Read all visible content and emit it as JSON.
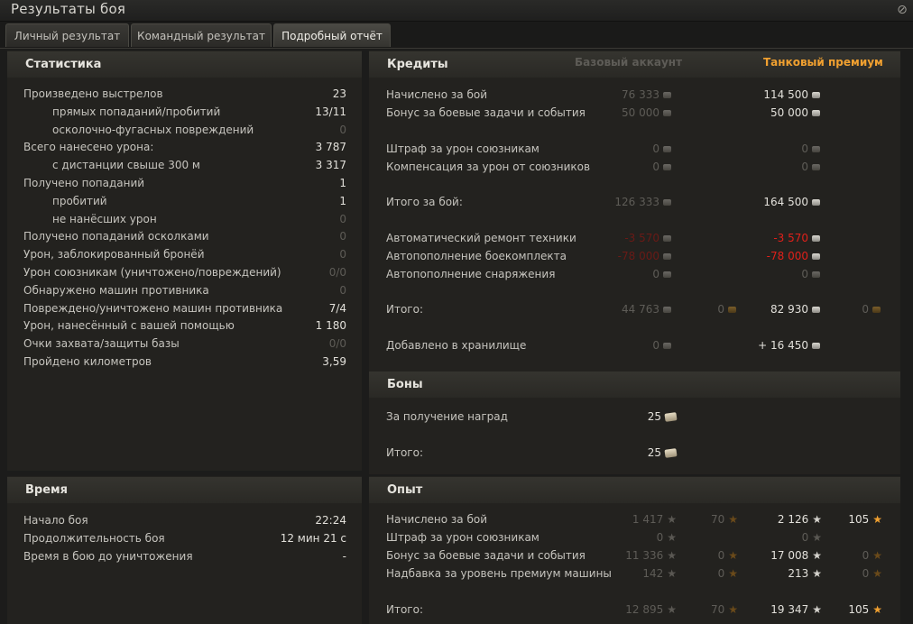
{
  "window": {
    "title": "Результаты боя"
  },
  "tabs": [
    {
      "label": "Личный результат"
    },
    {
      "label": "Командный результат"
    },
    {
      "label": "Подробный отчёт"
    }
  ],
  "stats": {
    "header": "Статистика",
    "rows": [
      {
        "label": "Произведено выстрелов",
        "value": "23"
      },
      {
        "label": "прямых попаданий/пробитий",
        "value": "13/11"
      },
      {
        "label": "осколочно-фугасных повреждений",
        "value": "0"
      },
      {
        "label": "Всего нанесено урона:",
        "value": "3 787"
      },
      {
        "label": "с дистанции свыше 300 м",
        "value": "3 317"
      },
      {
        "label": "Получено попаданий",
        "value": "1"
      },
      {
        "label": "пробитий",
        "value": "1"
      },
      {
        "label": "не нанёсших урон",
        "value": "0"
      },
      {
        "label": "Получено попаданий осколками",
        "value": "0"
      },
      {
        "label": "Урон, заблокированный бронёй",
        "value": "0"
      },
      {
        "label": "Урон союзникам (уничтожено/повреждений)",
        "value": "0/0"
      },
      {
        "label": "Обнаружено машин противника",
        "value": "0"
      },
      {
        "label": "Повреждено/уничтожено машин противника",
        "value": "7/4"
      },
      {
        "label": "Урон, нанесённый с вашей помощью",
        "value": "1 180"
      },
      {
        "label": "Очки захвата/защиты базы",
        "value": "0/0"
      },
      {
        "label": "Пройдено километров",
        "value": "3,59"
      }
    ]
  },
  "time": {
    "header": "Время",
    "rows": [
      {
        "label": "Начало боя",
        "value": "22:24"
      },
      {
        "label": "Продолжительность боя",
        "value": "12 мин 21 с"
      },
      {
        "label": "Время в бою до уничтожения",
        "value": "-"
      }
    ]
  },
  "credits": {
    "header": "Кредиты",
    "col_basic": "Базовый аккаунт",
    "col_premium": "Танковый премиум",
    "rows": [
      {
        "label": "Начислено за бой",
        "basic": "76 333",
        "premium": "114 500"
      },
      {
        "label": "Бонус за боевые задачи и события",
        "basic": "50 000",
        "premium": "50 000"
      },
      {
        "label": "Штраф за урон союзникам",
        "basic": "0",
        "premium": "0"
      },
      {
        "label": "Компенсация за урон от союзников",
        "basic": "0",
        "premium": "0"
      },
      {
        "label": "Итого за бой:",
        "basic": "126 333",
        "premium": "164 500"
      },
      {
        "label": "Автоматический ремонт техники",
        "basic": "-3 570",
        "premium": "-3 570"
      },
      {
        "label": "Автопополнение боекомплекта",
        "basic": "-78 000",
        "premium": "-78 000"
      },
      {
        "label": "Автопополнение снаряжения",
        "basic": "0",
        "premium": "0"
      },
      {
        "label": "Итого:",
        "basic": "44 763",
        "basic_gold": "0",
        "premium": "82 930",
        "premium_gold": "0"
      },
      {
        "label": "Добавлено в хранилище",
        "basic": "0",
        "premium": "+ 16 450"
      }
    ]
  },
  "bonds": {
    "header": "Боны",
    "rows": [
      {
        "label": "За получение наград",
        "value": "25"
      },
      {
        "label": "Итого:",
        "value": "25"
      }
    ]
  },
  "experience": {
    "header": "Опыт",
    "rows": [
      {
        "label": "Начислено за бой",
        "b1": "1 417",
        "b2": "70",
        "p1": "2 126",
        "p2": "105"
      },
      {
        "label": "Штраф за урон союзникам",
        "b1": "0",
        "b2": "",
        "p1": "0",
        "p2": ""
      },
      {
        "label": "Бонус за боевые задачи и события",
        "b1": "11 336",
        "b2": "0",
        "p1": "17 008",
        "p2": "0"
      },
      {
        "label": "Надбавка за уровень премиум машины",
        "b1": "142",
        "b2": "0",
        "p1": "213",
        "p2": "0"
      },
      {
        "label": "Итого:",
        "b1": "12 895",
        "b2": "70",
        "p1": "19 347",
        "p2": "105"
      }
    ]
  },
  "colors": {
    "accent": "#f0a030",
    "negative": "#e0201a",
    "background": "#1c1c1b"
  }
}
